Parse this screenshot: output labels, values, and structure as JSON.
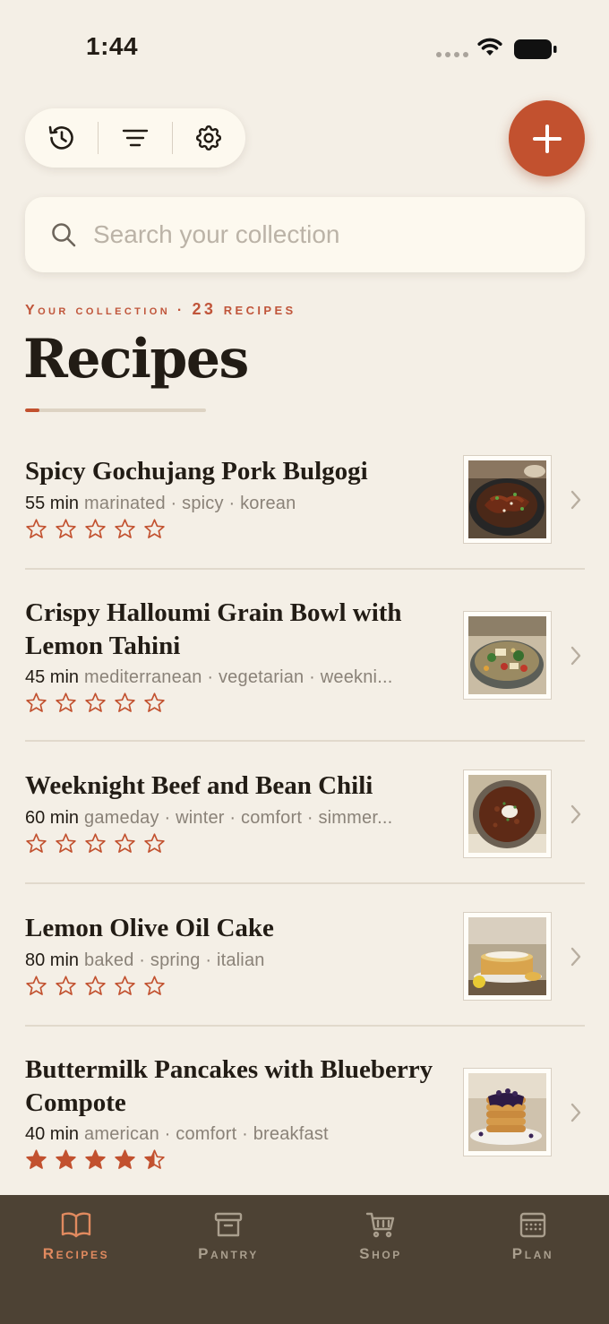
{
  "status": {
    "time": "1:44"
  },
  "search": {
    "placeholder": "Search your collection"
  },
  "header": {
    "collection_label": "Your collection",
    "separator": "·",
    "count_label": "23 recipes",
    "title": "Recipes"
  },
  "colors": {
    "accent": "#c2512f",
    "background": "#f4efe6",
    "tab_bar": "#4d4234",
    "active_tab": "#e18a5f"
  },
  "icons": {
    "toolbar": [
      "history-icon",
      "filter-icon",
      "settings-icon"
    ],
    "fab": "plus-icon",
    "search": "search-icon",
    "row": "chevron-right-icon",
    "rating": "star-icon"
  },
  "recipes": [
    {
      "title": "Spicy Gochujang Pork Bulgogi",
      "time": "55 min",
      "tags": "marinated · spicy · korean",
      "rating": 0
    },
    {
      "title": "Crispy Halloumi Grain Bowl with Lemon Tahini",
      "time": "45 min",
      "tags": "mediterranean · vegetarian · weekni...",
      "rating": 0
    },
    {
      "title": "Weeknight Beef and Bean Chili",
      "time": "60 min",
      "tags": "gameday · winter · comfort · simmer...",
      "rating": 0
    },
    {
      "title": "Lemon Olive Oil Cake",
      "time": "80 min",
      "tags": "baked · spring · italian",
      "rating": 0
    },
    {
      "title": "Buttermilk Pancakes with Blueberry Compote",
      "time": "40 min",
      "tags": "american · comfort · breakfast",
      "rating": 4.5
    }
  ],
  "tabs": [
    {
      "label": "Recipes",
      "icon": "book-icon",
      "active": true
    },
    {
      "label": "Pantry",
      "icon": "archive-icon",
      "active": false
    },
    {
      "label": "Shop",
      "icon": "cart-icon",
      "active": false
    },
    {
      "label": "Plan",
      "icon": "calendar-icon",
      "active": false
    }
  ]
}
